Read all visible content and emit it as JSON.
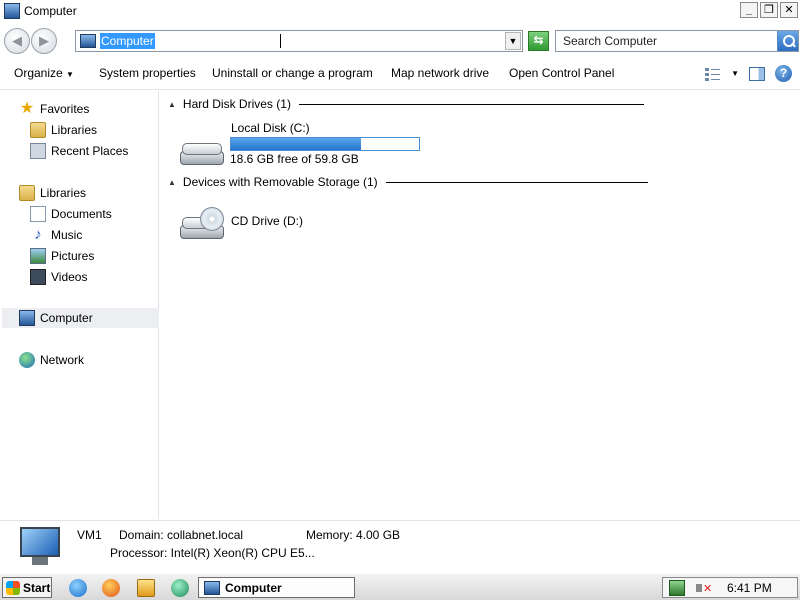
{
  "window": {
    "title": "Computer",
    "controls": {
      "minimize": "_",
      "maximize": "❐",
      "close": "✕"
    }
  },
  "address_bar": {
    "value": "Computer",
    "search_placeholder": "Search Computer"
  },
  "toolbar": {
    "organize": "Organize",
    "system_properties": "System properties",
    "uninstall": "Uninstall or change a program",
    "map_drive": "Map network drive",
    "control_panel": "Open Control Panel"
  },
  "sidebar": {
    "favorites": "Favorites",
    "favorites_libraries": "Libraries",
    "recent_places": "Recent Places",
    "libraries": "Libraries",
    "documents": "Documents",
    "music": "Music",
    "pictures": "Pictures",
    "videos": "Videos",
    "computer": "Computer",
    "network": "Network"
  },
  "main": {
    "hard_disk_header": "Hard Disk Drives (1)",
    "removable_header": "Devices with Removable Storage (1)",
    "local_disk": {
      "name": "Local Disk (C:)",
      "free_text": "18.6 GB free of 59.8 GB",
      "used_fraction": 0.689
    },
    "cd_drive": {
      "name": "CD Drive (D:)"
    }
  },
  "details": {
    "computer_name": "VM1",
    "domain": "Domain: collabnet.local",
    "memory": "Memory: 4.00 GB",
    "processor": "Processor: Intel(R) Xeon(R) CPU E5..."
  },
  "taskbar": {
    "start": "Start",
    "active_task": "Computer",
    "clock": "6:41 PM"
  },
  "colors": {
    "selection": "#3399ff",
    "usage_bar": "#2476cf"
  }
}
